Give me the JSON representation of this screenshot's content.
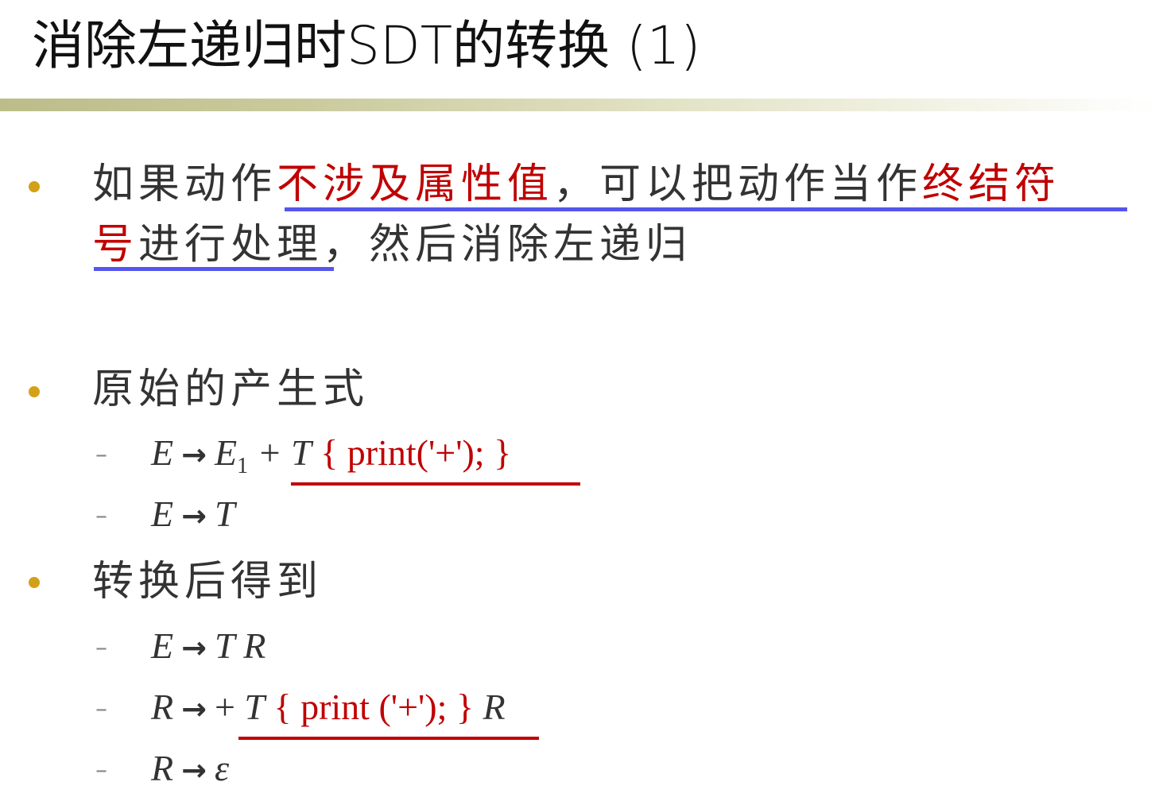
{
  "slide": {
    "title": "消除左递归时SDT的转换 (1)",
    "bullet1": {
      "line1_a": "如果动作",
      "line1_b": "不涉及属性值",
      "line1_c": "，可以把动作当作",
      "line1_d": "终结符",
      "line2_a": "号",
      "line2_b": "进行处理",
      "line2_c": "，然后消除左递归"
    },
    "bullet2": {
      "text": "原始的产生式"
    },
    "bullet3": {
      "text": "转换后得到"
    },
    "dash": "–",
    "arrow": "→",
    "original_productions": [
      {
        "lhs": "E",
        "rhs_a": "E",
        "sub": "1",
        "rhs_b": " + T",
        "action": " { print('+'); }"
      },
      {
        "lhs": "E",
        "rhs": "T"
      }
    ],
    "converted_productions": [
      {
        "lhs": "E",
        "rhs": "T R"
      },
      {
        "lhs": "R",
        "rhs_a": "+ ",
        "rhs_t": "T",
        "action": " { print ('+'); }",
        "rhs_b": " R"
      },
      {
        "lhs": "R",
        "rhs": "ε"
      }
    ],
    "colors": {
      "accent_red": "#c00000",
      "underline_blue": "#5555ee",
      "bullet": "#d4a017"
    }
  }
}
